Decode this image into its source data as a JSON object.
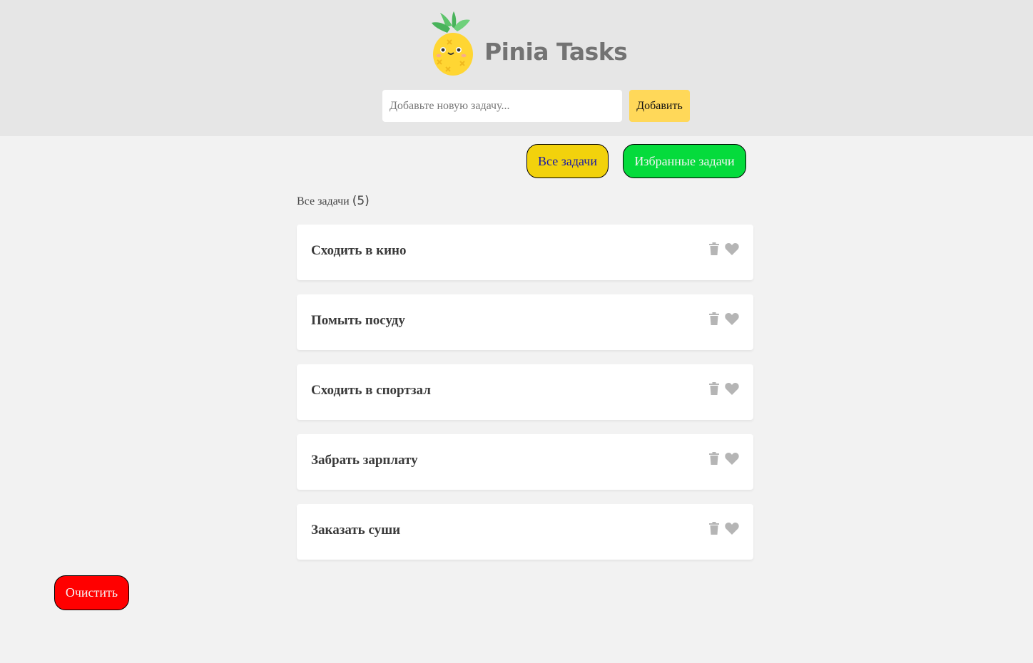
{
  "header": {
    "logo_icon": "pineapple-icon",
    "brand": "Pinia Tasks",
    "input_placeholder": "Добавьте новую задачу...",
    "add_label": "Добавить"
  },
  "filters": {
    "all_label": "Все задачи",
    "favorites_label": "Избранные задачи"
  },
  "summary": {
    "label": "Все задачи",
    "count": "(5)"
  },
  "tasks": [
    {
      "title": "Сходить в кино"
    },
    {
      "title": "Помыть посуду"
    },
    {
      "title": "Сходить в спортзал"
    },
    {
      "title": "Забрать зарплату"
    },
    {
      "title": "Заказать суши"
    }
  ],
  "icons": {
    "delete": "trash-icon",
    "favorite": "heart-icon"
  },
  "footer": {
    "clear_label": "Очистить"
  },
  "colors": {
    "header_bg": "#e6e6e6",
    "page_bg": "#f2f2f2",
    "add_button": "#ffd859",
    "all_button": "#f2d20c",
    "favorites_button": "#05db3c",
    "clear_button": "#ff0000",
    "icon_gray": "#b5b5b5"
  }
}
